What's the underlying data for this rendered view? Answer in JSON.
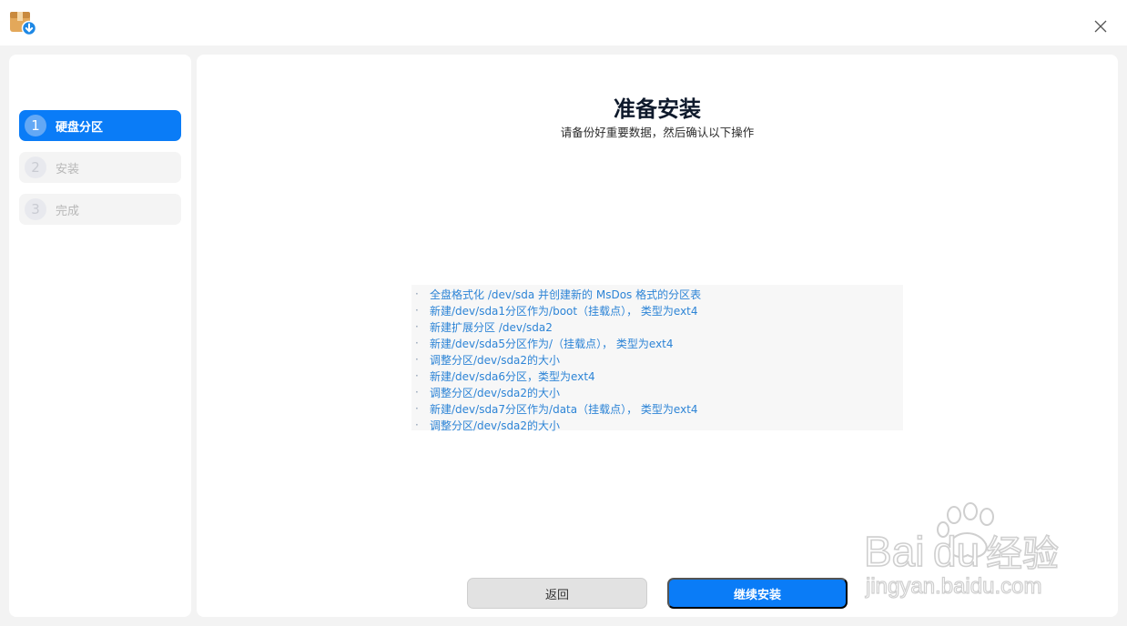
{
  "window": {
    "app_icon": "installer-package-icon",
    "close_icon": "close-icon"
  },
  "sidebar": {
    "steps": [
      {
        "num": "1",
        "label": "硬盘分区",
        "active": true
      },
      {
        "num": "2",
        "label": "安装",
        "active": false
      },
      {
        "num": "3",
        "label": "完成",
        "active": false
      }
    ]
  },
  "main": {
    "title": "准备安装",
    "subtitle": "请备份好重要数据，然后确认以下操作",
    "bullet": "·",
    "operations": [
      "全盘格式化 /dev/sda 并创建新的 MsDos 格式的分区表",
      "新建/dev/sda1分区作为/boot（挂载点）， 类型为ext4",
      "新建扩展分区 /dev/sda2",
      "新建/dev/sda5分区作为/（挂载点）， 类型为ext4",
      "调整分区/dev/sda2的大小",
      "新建/dev/sda6分区，类型为ext4",
      "调整分区/dev/sda2的大小",
      "新建/dev/sda7分区作为/data（挂载点）， 类型为ext4",
      "调整分区/dev/sda2的大小"
    ],
    "back_label": "返回",
    "continue_label": "继续安装"
  },
  "watermark": {
    "brand": "Bai",
    "brand2": "du",
    "brand_cn": "经验",
    "url": "jingyan.baidu.com"
  },
  "colors": {
    "accent": "#0a7cf7",
    "op_text": "#2d84d6"
  }
}
